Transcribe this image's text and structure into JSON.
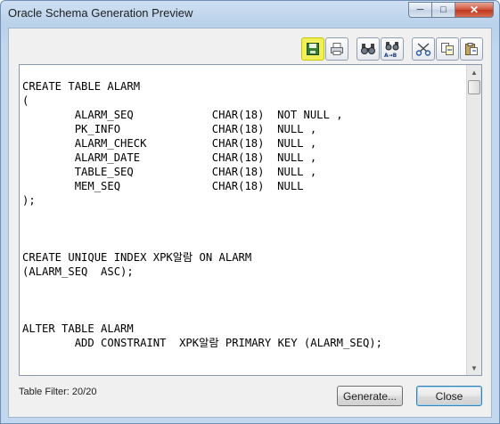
{
  "window": {
    "title": "Oracle Schema Generation Preview",
    "minimize_glyph": "─",
    "maximize_glyph": "□",
    "close_glyph": "✕"
  },
  "toolbar": {
    "buttons": [
      {
        "name": "save-icon",
        "highlighted": true
      },
      {
        "name": "print-icon"
      },
      {
        "name": "find-icon"
      },
      {
        "name": "find-replace-icon"
      },
      {
        "name": "cut-icon"
      },
      {
        "name": "copy-icon"
      },
      {
        "name": "paste-icon"
      }
    ],
    "find_replace_text": "A→B"
  },
  "editor": {
    "lines": [
      "CREATE TABLE ALARM",
      "(",
      "        ALARM_SEQ            CHAR(18)  NOT NULL ,",
      "        PK_INFO              CHAR(18)  NULL ,",
      "        ALARM_CHECK          CHAR(18)  NULL ,",
      "        ALARM_DATE           CHAR(18)  NULL ,",
      "        TABLE_SEQ            CHAR(18)  NULL ,",
      "        MEM_SEQ              CHAR(18)  NULL",
      ");",
      "",
      "",
      "",
      "CREATE UNIQUE INDEX XPK알람 ON ALARM",
      "(ALARM_SEQ  ASC);",
      "",
      "",
      "",
      "ALTER TABLE ALARM",
      "        ADD CONSTRAINT  XPK알람 PRIMARY KEY (ALARM_SEQ);",
      ""
    ],
    "scroll_up_glyph": "▲",
    "scroll_down_glyph": "▼"
  },
  "footer": {
    "table_filter": "Table Filter: 20/20",
    "generate_label": "Generate...",
    "close_label": "Close"
  }
}
